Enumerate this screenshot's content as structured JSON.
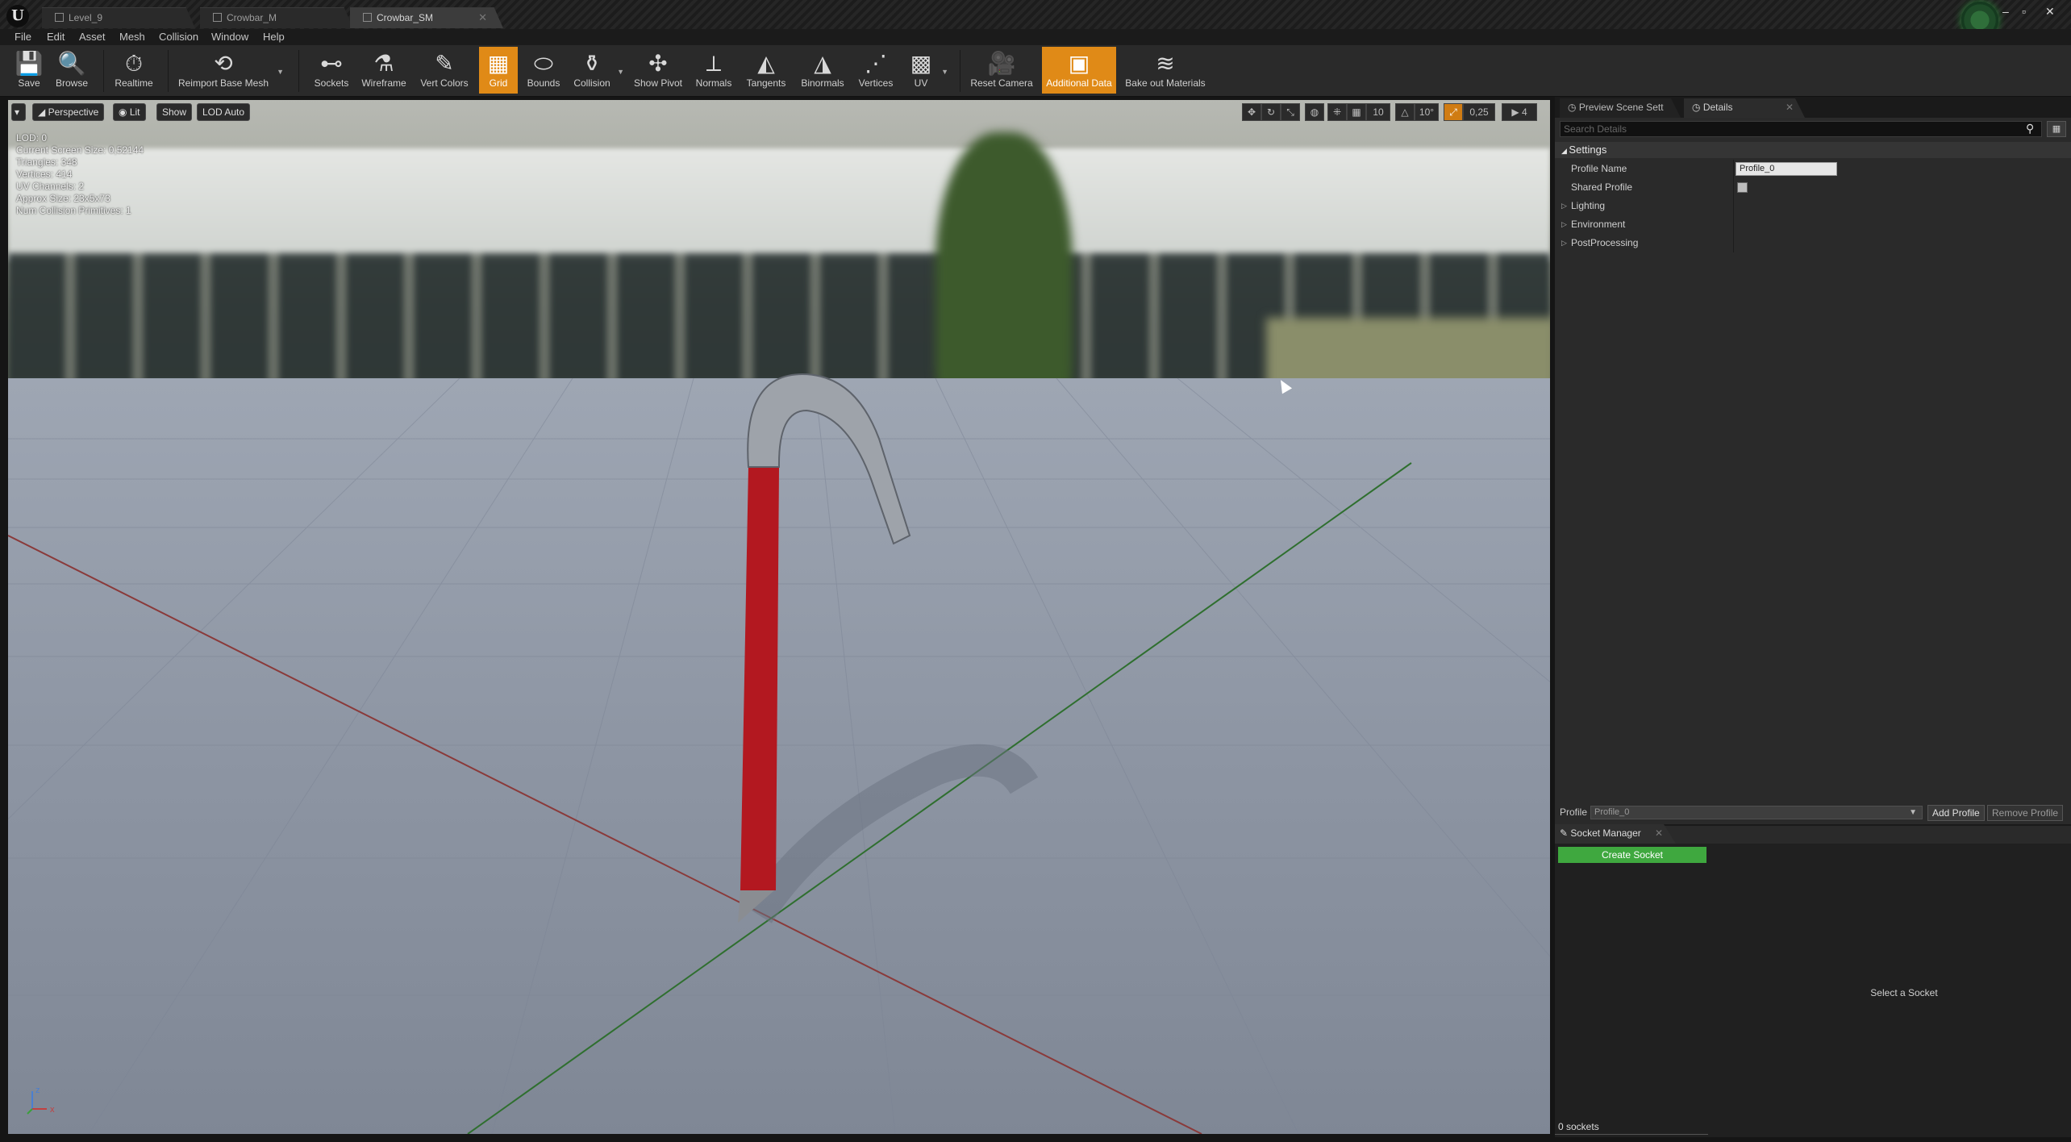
{
  "window": {
    "tabs": [
      {
        "label": "Level_9",
        "active": false
      },
      {
        "label": "Crowbar_M",
        "active": false
      },
      {
        "label": "Crowbar_SM",
        "active": true
      }
    ],
    "controls": {
      "minimize": "‒",
      "maximize": "▫",
      "close": "✕"
    }
  },
  "menu": [
    "File",
    "Edit",
    "Asset",
    "Mesh",
    "Collision",
    "Window",
    "Help"
  ],
  "toolbar": {
    "items": [
      {
        "label": "Save",
        "icon": "save-icon",
        "glyph": "💾"
      },
      {
        "label": "Browse",
        "icon": "browse-icon",
        "glyph": "🔍"
      },
      {
        "label": "Realtime",
        "icon": "realtime-icon",
        "glyph": "⏱"
      },
      {
        "label": "Reimport Base Mesh",
        "icon": "reimport-icon",
        "glyph": "⟲"
      },
      {
        "label": "Sockets",
        "icon": "sockets-icon",
        "glyph": "⊷"
      },
      {
        "label": "Wireframe",
        "icon": "wireframe-icon",
        "glyph": "⚗"
      },
      {
        "label": "Vert Colors",
        "icon": "vert-colors-icon",
        "glyph": "✎"
      },
      {
        "label": "Grid",
        "icon": "grid-icon",
        "glyph": "▦"
      },
      {
        "label": "Bounds",
        "icon": "bounds-icon",
        "glyph": "⬭"
      },
      {
        "label": "Collision",
        "icon": "collision-icon",
        "glyph": "⚱"
      },
      {
        "label": "Show Pivot",
        "icon": "show-pivot-icon",
        "glyph": "✣"
      },
      {
        "label": "Normals",
        "icon": "normals-icon",
        "glyph": "⟂"
      },
      {
        "label": "Tangents",
        "icon": "tangents-icon",
        "glyph": "◭"
      },
      {
        "label": "Binormals",
        "icon": "binormals-icon",
        "glyph": "◮"
      },
      {
        "label": "Vertices",
        "icon": "vertices-icon",
        "glyph": "⋰"
      },
      {
        "label": "UV",
        "icon": "uv-icon",
        "glyph": "▩"
      },
      {
        "label": "Reset Camera",
        "icon": "reset-camera-icon",
        "glyph": "🎥"
      },
      {
        "label": "Additional Data",
        "icon": "additional-data-icon",
        "glyph": "▣"
      },
      {
        "label": "Bake out Materials",
        "icon": "bake-materials-icon",
        "glyph": "≋"
      }
    ],
    "active": [
      "Grid",
      "Additional Data"
    ],
    "accent": "#e08a17"
  },
  "viewport": {
    "options_button": "▾",
    "perspective": "Perspective",
    "lit": "Lit",
    "show": "Show",
    "lod": "LOD Auto",
    "stats": [
      "LOD:  0",
      "Current Screen Size:  0,52144",
      "Triangles:  348",
      "Vertices:  414",
      "UV Channels:  2",
      "Approx Size: 23x5x73",
      "Num Collision Primitives:  1"
    ],
    "grid_snap": "10",
    "rot_snap": "10°",
    "scale_snap": "0,25",
    "camera_speed": "4",
    "axis": {
      "z": "z",
      "x": "x"
    }
  },
  "details": {
    "tabs": [
      {
        "label": "Preview Scene Sett",
        "icon": "preview-scene-icon"
      },
      {
        "label": "Details",
        "icon": "details-icon"
      }
    ],
    "search_placeholder": "Search Details",
    "category": "Settings",
    "profile_name_label": "Profile Name",
    "profile_name_value": "Profile_0",
    "shared_profile_label": "Shared Profile",
    "subcategories": [
      "Lighting",
      "Environment",
      "PostProcessing"
    ],
    "profile_label": "Profile",
    "profile_select": "Profile_0",
    "add_profile": "Add Profile",
    "remove_profile": "Remove Profile"
  },
  "socket_manager": {
    "tab": "Socket Manager",
    "create_button": "Create Socket",
    "empty_message": "Select a Socket",
    "count": "0 sockets",
    "button_color": "#3fa83f"
  }
}
